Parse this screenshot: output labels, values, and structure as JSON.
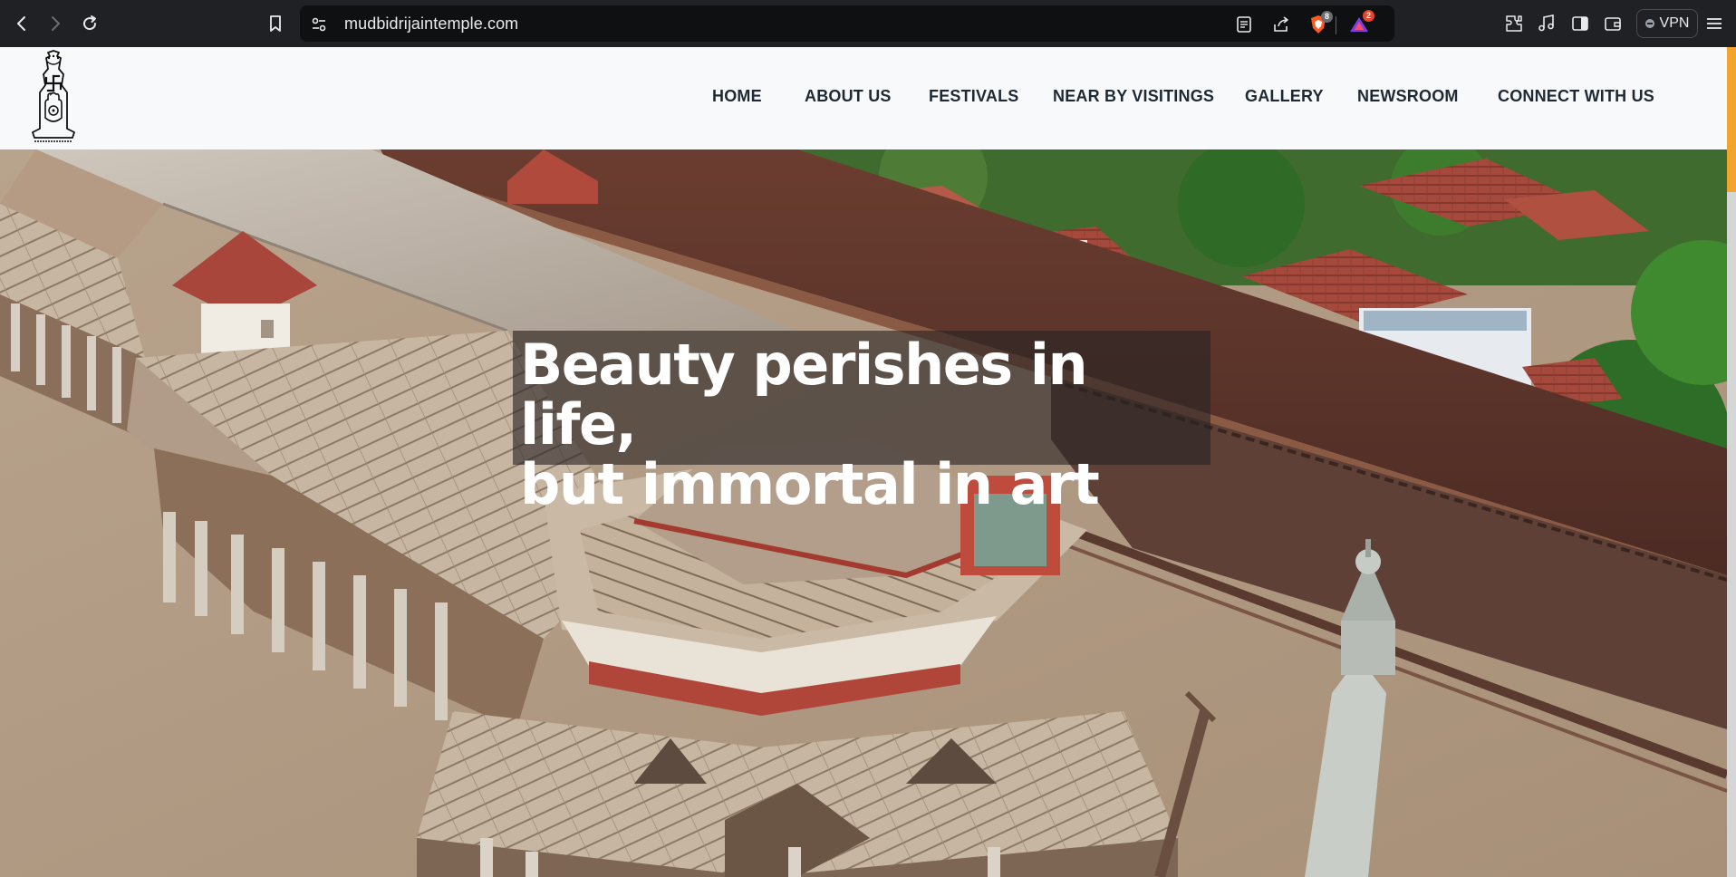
{
  "browser": {
    "url": "mudbidrijaintemple.com",
    "shield_badge": "8",
    "rewards_badge": "2",
    "vpn_label": "VPN",
    "colors": {
      "shield": "#ff5a1f",
      "rewards": "#7b3fe4",
      "badge_red": "#e8442c"
    }
  },
  "site": {
    "logo_icon": "jain-symbol-logo",
    "nav": [
      {
        "label": "HOME"
      },
      {
        "label": "ABOUT US"
      },
      {
        "label": "FESTIVALS"
      },
      {
        "label": "NEAR BY VISITINGS"
      },
      {
        "label": "GALLERY"
      },
      {
        "label": "NEWSROOM"
      },
      {
        "label": "CONNECT WITH US"
      }
    ]
  },
  "hero": {
    "headline_line1": "Beauty perishes in life,",
    "headline_line2": "but immortal in art",
    "image": "aerial view of Jain temple complex"
  }
}
